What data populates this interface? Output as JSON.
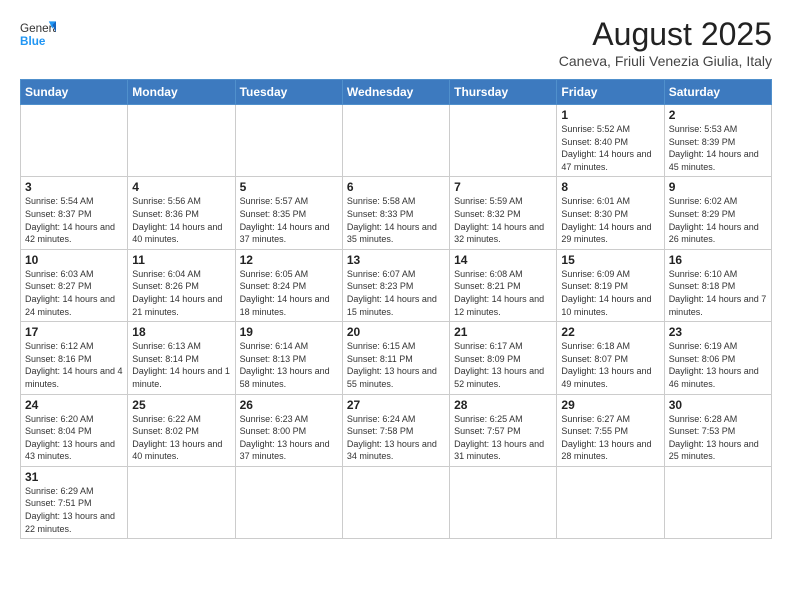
{
  "header": {
    "logo_general": "General",
    "logo_blue": "Blue",
    "title": "August 2025",
    "subtitle": "Caneva, Friuli Venezia Giulia, Italy"
  },
  "weekdays": [
    "Sunday",
    "Monday",
    "Tuesday",
    "Wednesday",
    "Thursday",
    "Friday",
    "Saturday"
  ],
  "weeks": [
    [
      {
        "day": "",
        "info": ""
      },
      {
        "day": "",
        "info": ""
      },
      {
        "day": "",
        "info": ""
      },
      {
        "day": "",
        "info": ""
      },
      {
        "day": "",
        "info": ""
      },
      {
        "day": "1",
        "info": "Sunrise: 5:52 AM\nSunset: 8:40 PM\nDaylight: 14 hours and 47 minutes."
      },
      {
        "day": "2",
        "info": "Sunrise: 5:53 AM\nSunset: 8:39 PM\nDaylight: 14 hours and 45 minutes."
      }
    ],
    [
      {
        "day": "3",
        "info": "Sunrise: 5:54 AM\nSunset: 8:37 PM\nDaylight: 14 hours and 42 minutes."
      },
      {
        "day": "4",
        "info": "Sunrise: 5:56 AM\nSunset: 8:36 PM\nDaylight: 14 hours and 40 minutes."
      },
      {
        "day": "5",
        "info": "Sunrise: 5:57 AM\nSunset: 8:35 PM\nDaylight: 14 hours and 37 minutes."
      },
      {
        "day": "6",
        "info": "Sunrise: 5:58 AM\nSunset: 8:33 PM\nDaylight: 14 hours and 35 minutes."
      },
      {
        "day": "7",
        "info": "Sunrise: 5:59 AM\nSunset: 8:32 PM\nDaylight: 14 hours and 32 minutes."
      },
      {
        "day": "8",
        "info": "Sunrise: 6:01 AM\nSunset: 8:30 PM\nDaylight: 14 hours and 29 minutes."
      },
      {
        "day": "9",
        "info": "Sunrise: 6:02 AM\nSunset: 8:29 PM\nDaylight: 14 hours and 26 minutes."
      }
    ],
    [
      {
        "day": "10",
        "info": "Sunrise: 6:03 AM\nSunset: 8:27 PM\nDaylight: 14 hours and 24 minutes."
      },
      {
        "day": "11",
        "info": "Sunrise: 6:04 AM\nSunset: 8:26 PM\nDaylight: 14 hours and 21 minutes."
      },
      {
        "day": "12",
        "info": "Sunrise: 6:05 AM\nSunset: 8:24 PM\nDaylight: 14 hours and 18 minutes."
      },
      {
        "day": "13",
        "info": "Sunrise: 6:07 AM\nSunset: 8:23 PM\nDaylight: 14 hours and 15 minutes."
      },
      {
        "day": "14",
        "info": "Sunrise: 6:08 AM\nSunset: 8:21 PM\nDaylight: 14 hours and 12 minutes."
      },
      {
        "day": "15",
        "info": "Sunrise: 6:09 AM\nSunset: 8:19 PM\nDaylight: 14 hours and 10 minutes."
      },
      {
        "day": "16",
        "info": "Sunrise: 6:10 AM\nSunset: 8:18 PM\nDaylight: 14 hours and 7 minutes."
      }
    ],
    [
      {
        "day": "17",
        "info": "Sunrise: 6:12 AM\nSunset: 8:16 PM\nDaylight: 14 hours and 4 minutes."
      },
      {
        "day": "18",
        "info": "Sunrise: 6:13 AM\nSunset: 8:14 PM\nDaylight: 14 hours and 1 minute."
      },
      {
        "day": "19",
        "info": "Sunrise: 6:14 AM\nSunset: 8:13 PM\nDaylight: 13 hours and 58 minutes."
      },
      {
        "day": "20",
        "info": "Sunrise: 6:15 AM\nSunset: 8:11 PM\nDaylight: 13 hours and 55 minutes."
      },
      {
        "day": "21",
        "info": "Sunrise: 6:17 AM\nSunset: 8:09 PM\nDaylight: 13 hours and 52 minutes."
      },
      {
        "day": "22",
        "info": "Sunrise: 6:18 AM\nSunset: 8:07 PM\nDaylight: 13 hours and 49 minutes."
      },
      {
        "day": "23",
        "info": "Sunrise: 6:19 AM\nSunset: 8:06 PM\nDaylight: 13 hours and 46 minutes."
      }
    ],
    [
      {
        "day": "24",
        "info": "Sunrise: 6:20 AM\nSunset: 8:04 PM\nDaylight: 13 hours and 43 minutes."
      },
      {
        "day": "25",
        "info": "Sunrise: 6:22 AM\nSunset: 8:02 PM\nDaylight: 13 hours and 40 minutes."
      },
      {
        "day": "26",
        "info": "Sunrise: 6:23 AM\nSunset: 8:00 PM\nDaylight: 13 hours and 37 minutes."
      },
      {
        "day": "27",
        "info": "Sunrise: 6:24 AM\nSunset: 7:58 PM\nDaylight: 13 hours and 34 minutes."
      },
      {
        "day": "28",
        "info": "Sunrise: 6:25 AM\nSunset: 7:57 PM\nDaylight: 13 hours and 31 minutes."
      },
      {
        "day": "29",
        "info": "Sunrise: 6:27 AM\nSunset: 7:55 PM\nDaylight: 13 hours and 28 minutes."
      },
      {
        "day": "30",
        "info": "Sunrise: 6:28 AM\nSunset: 7:53 PM\nDaylight: 13 hours and 25 minutes."
      }
    ],
    [
      {
        "day": "31",
        "info": "Sunrise: 6:29 AM\nSunset: 7:51 PM\nDaylight: 13 hours and 22 minutes."
      },
      {
        "day": "",
        "info": ""
      },
      {
        "day": "",
        "info": ""
      },
      {
        "day": "",
        "info": ""
      },
      {
        "day": "",
        "info": ""
      },
      {
        "day": "",
        "info": ""
      },
      {
        "day": "",
        "info": ""
      }
    ]
  ]
}
